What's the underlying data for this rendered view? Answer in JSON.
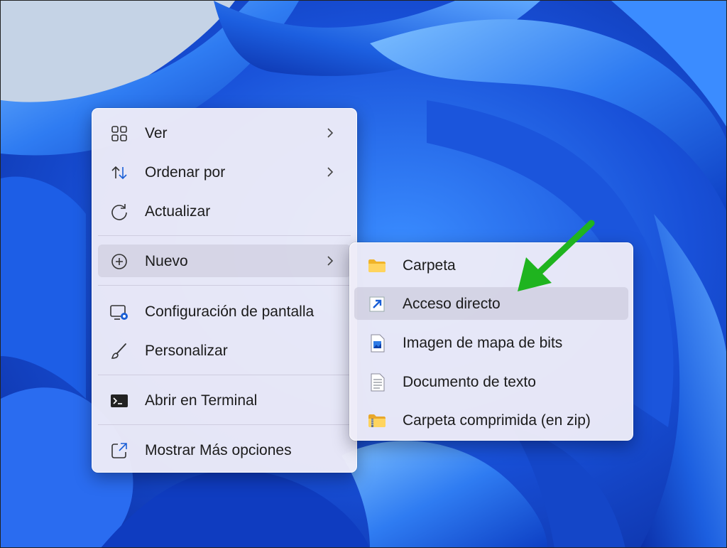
{
  "context_menu": {
    "items": [
      {
        "label": "Ver",
        "icon": "grid-view-icon",
        "has_submenu": true
      },
      {
        "label": "Ordenar por",
        "icon": "sort-icon",
        "has_submenu": true
      },
      {
        "label": "Actualizar",
        "icon": "refresh-icon",
        "has_submenu": false
      },
      {
        "label": "Nuevo",
        "icon": "add-circle-icon",
        "has_submenu": true,
        "highlighted": true
      },
      {
        "label": "Configuración de pantalla",
        "icon": "display-settings-icon",
        "has_submenu": false
      },
      {
        "label": "Personalizar",
        "icon": "brush-icon",
        "has_submenu": false
      },
      {
        "label": "Abrir en Terminal",
        "icon": "terminal-icon",
        "has_submenu": false
      },
      {
        "label": "Mostrar Más opciones",
        "icon": "open-external-icon",
        "has_submenu": false
      }
    ]
  },
  "submenu_nuevo": {
    "items": [
      {
        "label": "Carpeta",
        "icon": "folder-icon"
      },
      {
        "label": "Acceso directo",
        "icon": "shortcut-icon",
        "highlighted": true
      },
      {
        "label": "Imagen de mapa de bits",
        "icon": "bitmap-image-icon"
      },
      {
        "label": "Documento de texto",
        "icon": "text-document-icon"
      },
      {
        "label": "Carpeta comprimida (en zip)",
        "icon": "zip-folder-icon"
      }
    ]
  },
  "annotation": {
    "icon": "green-arrow-icon",
    "color": "#1fb41f"
  },
  "colors": {
    "menu_bg": "#eeecf8",
    "highlight": "#d6d4e4",
    "accent_blue": "#1a5fd6",
    "wallpaper_blue": "#1a4fd6"
  }
}
